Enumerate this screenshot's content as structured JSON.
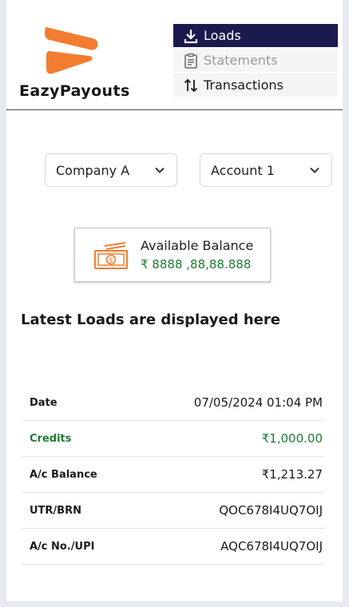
{
  "brand": {
    "name": "EazyPayouts",
    "accent": "#f27d31"
  },
  "nav": {
    "items": [
      {
        "label": "Loads",
        "icon": "download-icon",
        "state": "active"
      },
      {
        "label": "Statements",
        "icon": "clipboard-icon",
        "state": "disabled"
      },
      {
        "label": "Transactions",
        "icon": "swap-arrows-icon",
        "state": "normal"
      }
    ]
  },
  "filters": {
    "company": "Company A",
    "account": "Account 1"
  },
  "balance": {
    "label": "Available Balance",
    "value": "₹ 8888 ,88,88.888",
    "icon": "cash-icon"
  },
  "latest_heading": "Latest Loads are displayed here",
  "details": [
    {
      "key": "Date",
      "value": "07/05/2024 01:04 PM"
    },
    {
      "key": "Credits",
      "value": "₹1,000.00"
    },
    {
      "key": "A/c Balance",
      "value": "₹1,213.27"
    },
    {
      "key": "UTR/BRN",
      "value": "QOC678I4UQ7OIJ"
    },
    {
      "key": "A/c No./UPI",
      "value": "AQC678I4UQ7OIJ"
    }
  ],
  "colors": {
    "nav_active_bg": "#1a1a4e",
    "credit_green": "#1e7b34"
  }
}
